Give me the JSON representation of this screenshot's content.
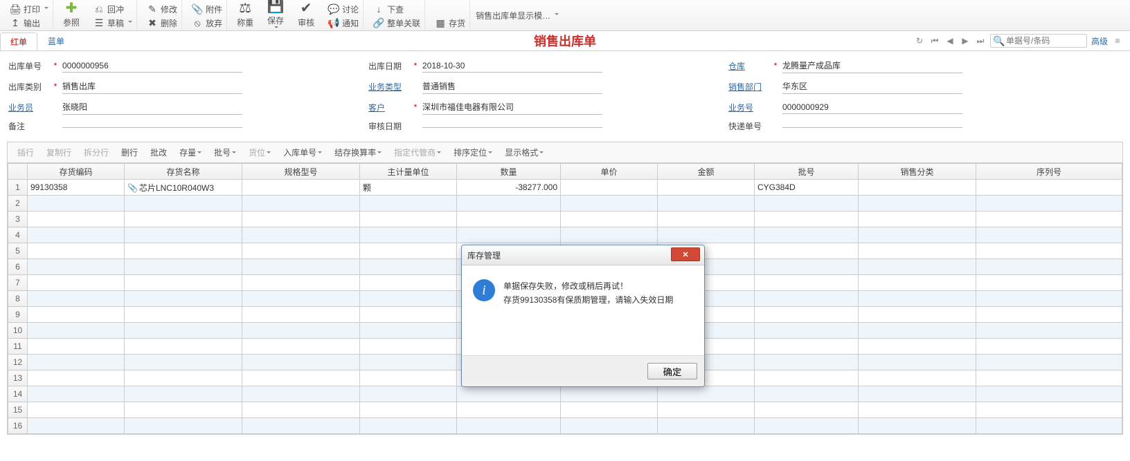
{
  "ribbon": {
    "print": "打印",
    "export": "输出",
    "reference": "参照",
    "draft": "草稿",
    "modify": "修改",
    "delete": "删除",
    "attachment": "附件",
    "discard": "放弃",
    "weighing": "称重",
    "save": "保存",
    "audit": "审核",
    "discuss": "讨论",
    "notify": "通知",
    "next_check": "下查",
    "whole_bill_relate": "整单关联",
    "result": "存货",
    "display_mode": "销售出库单显示模…"
  },
  "tabs": {
    "red": "红单",
    "blue": "蓝单"
  },
  "doc_title": "销售出库单",
  "nav": {
    "search_placeholder": "单据号/条码",
    "advanced": "高级"
  },
  "form": {
    "out_no_label": "出库单号",
    "out_no": "0000000956",
    "out_date_label": "出库日期",
    "out_date": "2018-10-30",
    "warehouse_label": "仓库",
    "warehouse": "龙腾量产成品库",
    "out_type_label": "出库类别",
    "out_type": "销售出库",
    "biz_type_label": "业务类型",
    "biz_type": "普通销售",
    "dept_label": "销售部门",
    "dept": "华东区",
    "salesman_label": "业务员",
    "salesman": "张晓阳",
    "customer_label": "客户",
    "customer": "深圳市福佳电器有限公司",
    "biz_no_label": "业务号",
    "biz_no": "0000000929",
    "remark_label": "备注",
    "remark": "",
    "audit_date_label": "审核日期",
    "audit_date": "",
    "express_no_label": "快递单号",
    "express_no": ""
  },
  "grid_toolbar": {
    "insert_row": "插行",
    "copy_row": "复制行",
    "split_row": "拆分行",
    "delete_row": "删行",
    "batch_modify": "批改",
    "stock": "存量",
    "batch_no": "批号",
    "location": "货位",
    "in_stock_no": "入库单号",
    "convert_rate": "结存换算率",
    "agent": "指定代管商",
    "sort_locate": "排序定位",
    "display_format": "显示格式"
  },
  "columns": {
    "code": "存货编码",
    "name": "存货名称",
    "spec": "规格型号",
    "unit": "主计量单位",
    "qty": "数量",
    "price": "单价",
    "amount": "金额",
    "batch": "批号",
    "sale_cat": "销售分类",
    "serial": "序列号"
  },
  "rows": [
    {
      "code": "99130358",
      "name": "芯片LNC10R040W3",
      "spec": "",
      "unit": "颗",
      "qty": "-38277.000",
      "price": "",
      "amount": "",
      "batch": "CYG384D",
      "sale_cat": "",
      "serial": "",
      "has_attachment": true
    }
  ],
  "dialog": {
    "title": "库存管理",
    "line1": "单据保存失败，修改或稍后再试！",
    "line2": "存货99130358有保质期管理，请输入失效日期",
    "ok": "确定"
  }
}
